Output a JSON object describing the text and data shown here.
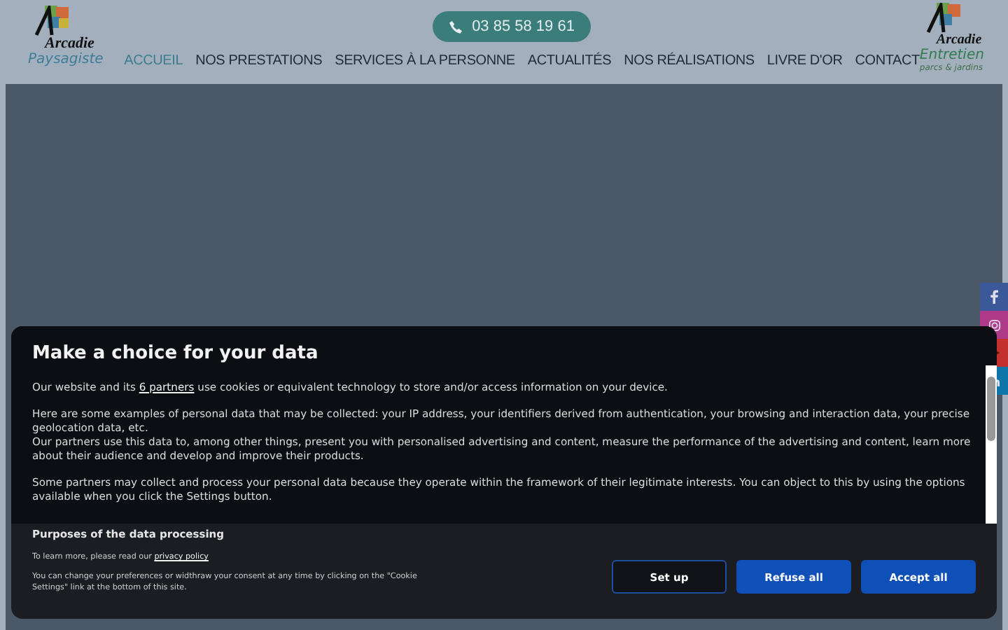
{
  "header": {
    "logo_left": {
      "name": "Arcadie",
      "tagline": "Paysagiste"
    },
    "phone": "03 85 58 19 61",
    "nav": [
      {
        "label": "ACCUEIL",
        "selected": true
      },
      {
        "label": "NOS PRESTATIONS",
        "selected": false
      },
      {
        "label": "SERVICES À LA PERSONNE",
        "selected": false
      },
      {
        "label": "ACTUALITÉS",
        "selected": false
      },
      {
        "label": "NOS RÉALISATIONS",
        "selected": false
      },
      {
        "label": "LIVRE D'OR",
        "selected": false
      },
      {
        "label": "CONTACT",
        "selected": false
      }
    ],
    "logo_right": {
      "name": "Arcadie",
      "tagline": "Entretien",
      "subtitle": "parcs & jardins"
    }
  },
  "social": [
    {
      "kind": "facebook",
      "color": "#3b5998"
    },
    {
      "kind": "instagram",
      "color": "#b03a8a"
    },
    {
      "kind": "youtube",
      "color": "#c4302b"
    },
    {
      "kind": "linkedin",
      "color": "#0e76a8"
    }
  ],
  "consent": {
    "title": "Make a choice for your data",
    "intro": {
      "before": "Our website and its",
      "link": "6 partners",
      "after": "use cookies or equivalent technology to store and/or access information on your device."
    },
    "paragraphs": [
      "Here are some examples of personal data that may be collected: your IP address, your identifiers derived from authentication, your browsing and interaction data, your precise geolocation data, etc.",
      "Our partners use this data to, among other things, present you with personalised advertising and content, measure the performance of the advertising and content, learn more about their audience and develop and improve their products.",
      "Some partners may collect and process your personal data because they operate within the framework of their legitimate interests. You can object to this by using the options available when you click the Settings button."
    ],
    "purposes": "Purposes of the data processing",
    "learn_more": "To learn more, please read our",
    "privacy_link": "privacy policy",
    "change_note": "You can change your preferences or widthraw your consent at any time by clicking on the \"Cookie Settings\" link at the bottom of this site.",
    "buttons": [
      {
        "label": "Set up",
        "kind": "outline"
      },
      {
        "label": "Refuse all",
        "kind": "primary"
      },
      {
        "label": "Accept all",
        "kind": "primary"
      }
    ]
  }
}
